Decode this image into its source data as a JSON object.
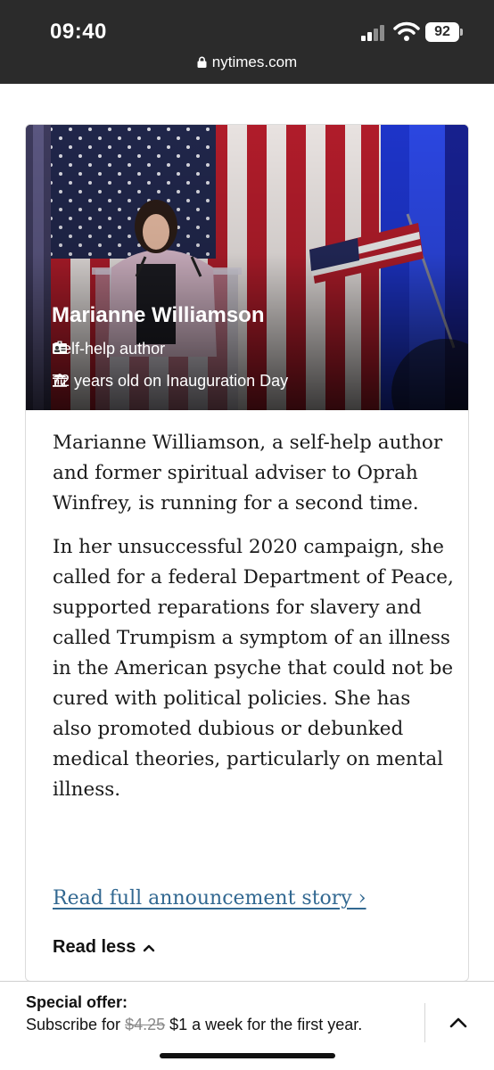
{
  "status": {
    "time": "09:40",
    "battery": "92"
  },
  "browser": {
    "url": "nytimes.com"
  },
  "card": {
    "name": "Marianne Williamson",
    "occupation": "Self-help author",
    "age_text": "72 years old on Inauguration Day",
    "paragraphs": [
      "Marianne Williamson, a self-help author and former spiritual adviser to Oprah Winfrey, is running for a second time.",
      "In her unsuccessful 2020 campaign, she called for a federal Department of Peace, supported reparations for slavery and called Trumpism a symptom of an illness in the American psyche that could not be cured with political policies. She has also promoted dubious or debunked medical theories, particularly on mental illness."
    ],
    "read_full_link": "Read full announcement story ›",
    "read_less": "Read less"
  },
  "banner": {
    "title": "Special offer:",
    "text_prefix": "Subscribe for ",
    "old_price": "$4.25",
    "text_suffix": " $1 a week for the first year."
  },
  "icons": {
    "lock": "lock-icon",
    "occupation": "id-badge-icon",
    "age": "capitol-building-icon",
    "read_less": "chevron-up-icon",
    "expand": "chevron-up-icon"
  },
  "colors": {
    "link": "#326891",
    "topbar": "#2b2b2b",
    "card_border": "#dcdcdc"
  }
}
